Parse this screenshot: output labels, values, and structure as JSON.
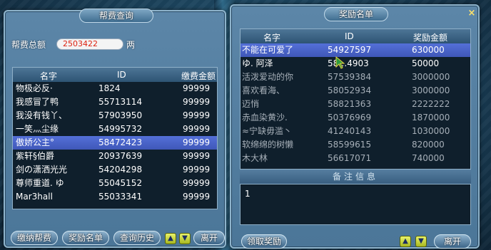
{
  "left_panel": {
    "title": "帮费查询",
    "total_label": "帮费总额",
    "total_value": "2503422",
    "total_unit": "两",
    "headers": [
      "名字",
      "ID",
      "缴费金额"
    ],
    "rows": [
      {
        "name": "物极必反·",
        "id": "1824",
        "amount": "99999"
      },
      {
        "name": "我感冒了鸭",
        "id": "55713114",
        "amount": "99999"
      },
      {
        "name": "我没有钱丫、",
        "id": "57903950",
        "amount": "99999"
      },
      {
        "name": "一笑灬尘缘",
        "id": "54995732",
        "amount": "99999"
      },
      {
        "name": "傲娇公主°",
        "id": "58472423",
        "amount": "99999"
      },
      {
        "name": "紫轩§伯爵",
        "id": "20937639",
        "amount": "99999"
      },
      {
        "name": "剑の潇洒光光",
        "id": "54204298",
        "amount": "99999"
      },
      {
        "name": "尊师重道. ゆ",
        "id": "55045152",
        "amount": "99999"
      },
      {
        "name": "Mar3hall",
        "id": "55033341",
        "amount": "99999"
      }
    ],
    "buttons": {
      "pay": "缴纳帮费",
      "reward_list": "奖励名单",
      "history": "查询历史",
      "leave": "离开"
    }
  },
  "right_panel": {
    "title": "奖励名单",
    "close": "×",
    "headers": [
      "名字",
      "ID",
      "奖励金额"
    ],
    "rows": [
      {
        "name": "不能在可爱了",
        "id": "54927597",
        "amount": "630000"
      },
      {
        "name": "ゆ. 阿泽",
        "id": "58…4903",
        "amount": "50000"
      },
      {
        "name": "活泼爱动的你",
        "id": "57539384",
        "amount": "3000000"
      },
      {
        "name": "喜欢看海、",
        "id": "58052934",
        "amount": "3000000"
      },
      {
        "name": "迈悄",
        "id": "58821363",
        "amount": "2222222"
      },
      {
        "name": "赤血染黄沙.",
        "id": "50376969",
        "amount": "1870000"
      },
      {
        "name": "≈宁缺毋滥丶",
        "id": "41240143",
        "amount": "1030000"
      },
      {
        "name": "软绵绵的树懒",
        "id": "58599615",
        "amount": "820000"
      },
      {
        "name": "木大林",
        "id": "56617071",
        "amount": "740000"
      }
    ],
    "notes_title": "备注信息",
    "notes_text": "1",
    "buttons": {
      "claim": "领取奖励",
      "leave": "离开"
    }
  },
  "arrows": {
    "up": "▲",
    "down": "▼"
  }
}
